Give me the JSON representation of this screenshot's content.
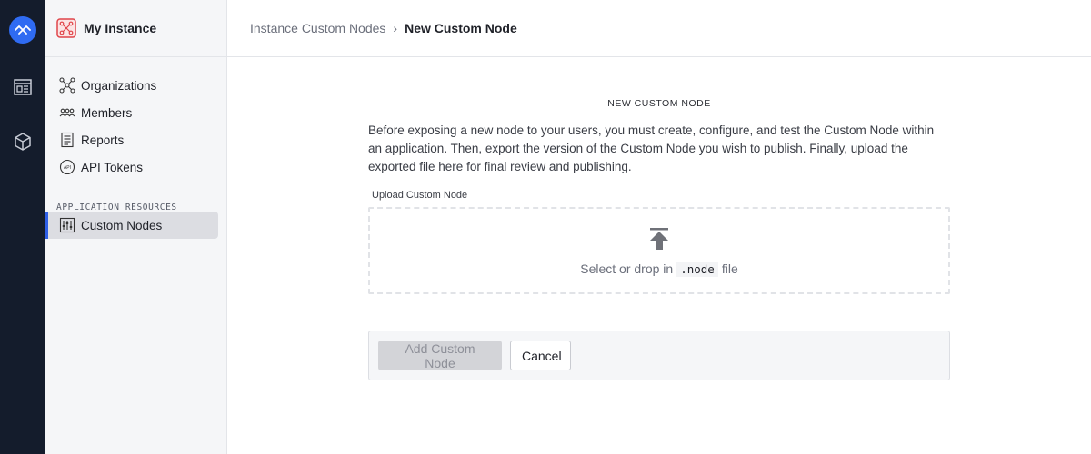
{
  "rail": {
    "logo_icon": "instance-logo-icon",
    "items": [
      "dashboard-icon",
      "cube-icon"
    ],
    "background": "#141c2c",
    "accent": "#2f6bf2"
  },
  "sidebar": {
    "instance_name": "My Instance",
    "items": [
      {
        "label": "Organizations",
        "icon": "organizations-icon"
      },
      {
        "label": "Members",
        "icon": "members-icon"
      },
      {
        "label": "Reports",
        "icon": "reports-icon"
      },
      {
        "label": "API Tokens",
        "icon": "api-icon"
      }
    ],
    "section_label": "APPLICATION RESOURCES",
    "active_item": {
      "label": "Custom Nodes",
      "icon": "sliders-icon"
    }
  },
  "breadcrumb": {
    "parent": "Instance Custom Nodes",
    "separator": "›",
    "current": "New Custom Node"
  },
  "form": {
    "section_title": "NEW CUSTOM NODE",
    "description": "Before exposing a new node to your users, you must create, configure, and test the Custom Node within an application. Then, export the version of the Custom Node you wish to publish. Finally, upload the exported file here for final review and publishing.",
    "upload_label": "Upload Custom Node",
    "dropzone": {
      "prefix": "Select or drop in",
      "extension": ".node",
      "suffix": "file",
      "icon": "upload-icon"
    },
    "submit_label": "Add Custom Node",
    "submit_disabled": true,
    "cancel_label": "Cancel"
  }
}
